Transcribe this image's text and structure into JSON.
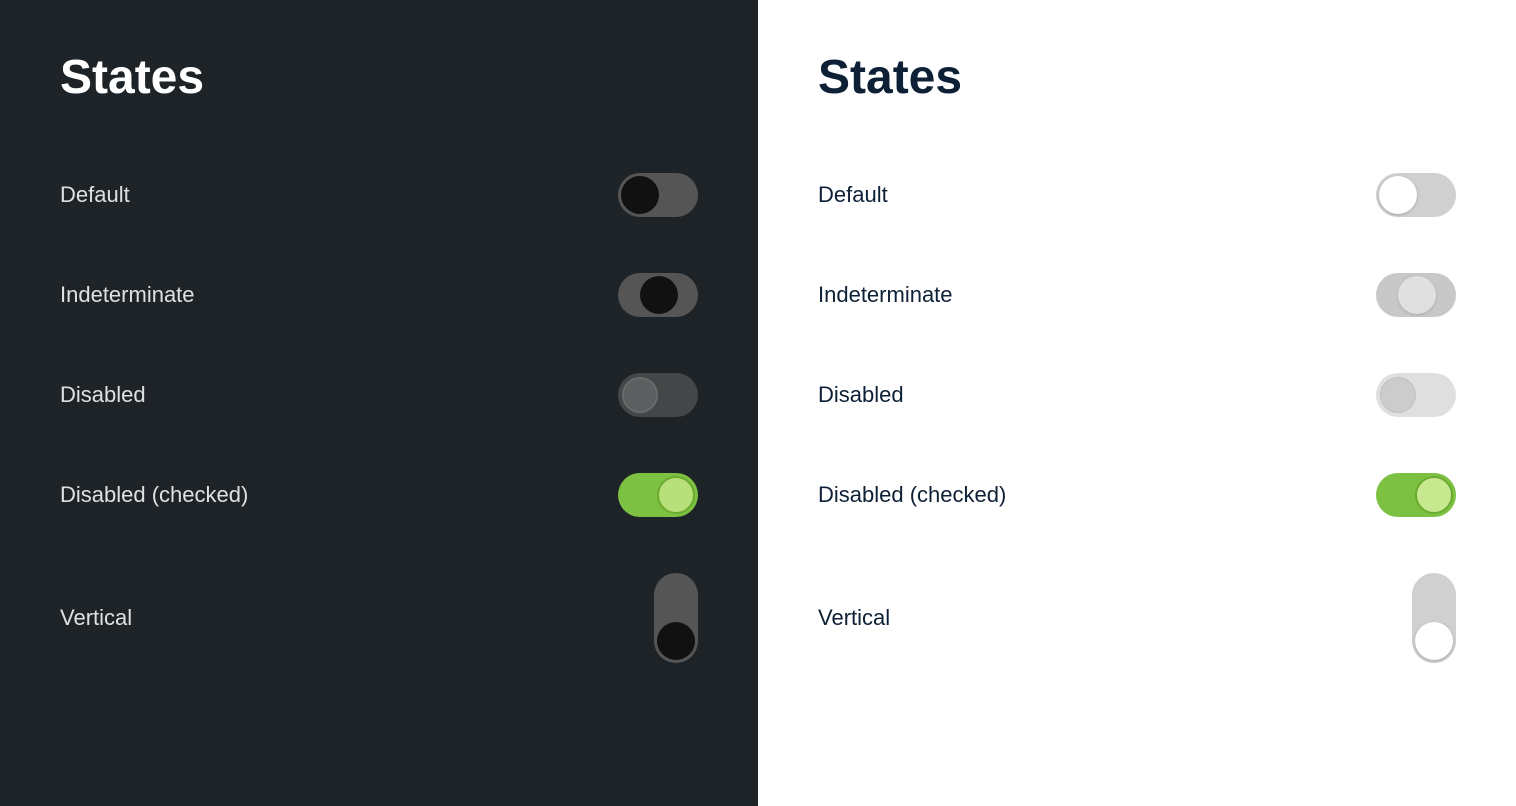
{
  "dark_panel": {
    "title": "States",
    "states": [
      {
        "id": "default",
        "label": "Default"
      },
      {
        "id": "indeterminate",
        "label": "Indeterminate"
      },
      {
        "id": "disabled",
        "label": "Disabled"
      },
      {
        "id": "disabled-checked",
        "label": "Disabled (checked)"
      },
      {
        "id": "vertical",
        "label": "Vertical"
      }
    ]
  },
  "light_panel": {
    "title": "States",
    "states": [
      {
        "id": "default",
        "label": "Default"
      },
      {
        "id": "indeterminate",
        "label": "Indeterminate"
      },
      {
        "id": "disabled",
        "label": "Disabled"
      },
      {
        "id": "disabled-checked",
        "label": "Disabled (checked)"
      },
      {
        "id": "vertical",
        "label": "Vertical"
      }
    ]
  }
}
